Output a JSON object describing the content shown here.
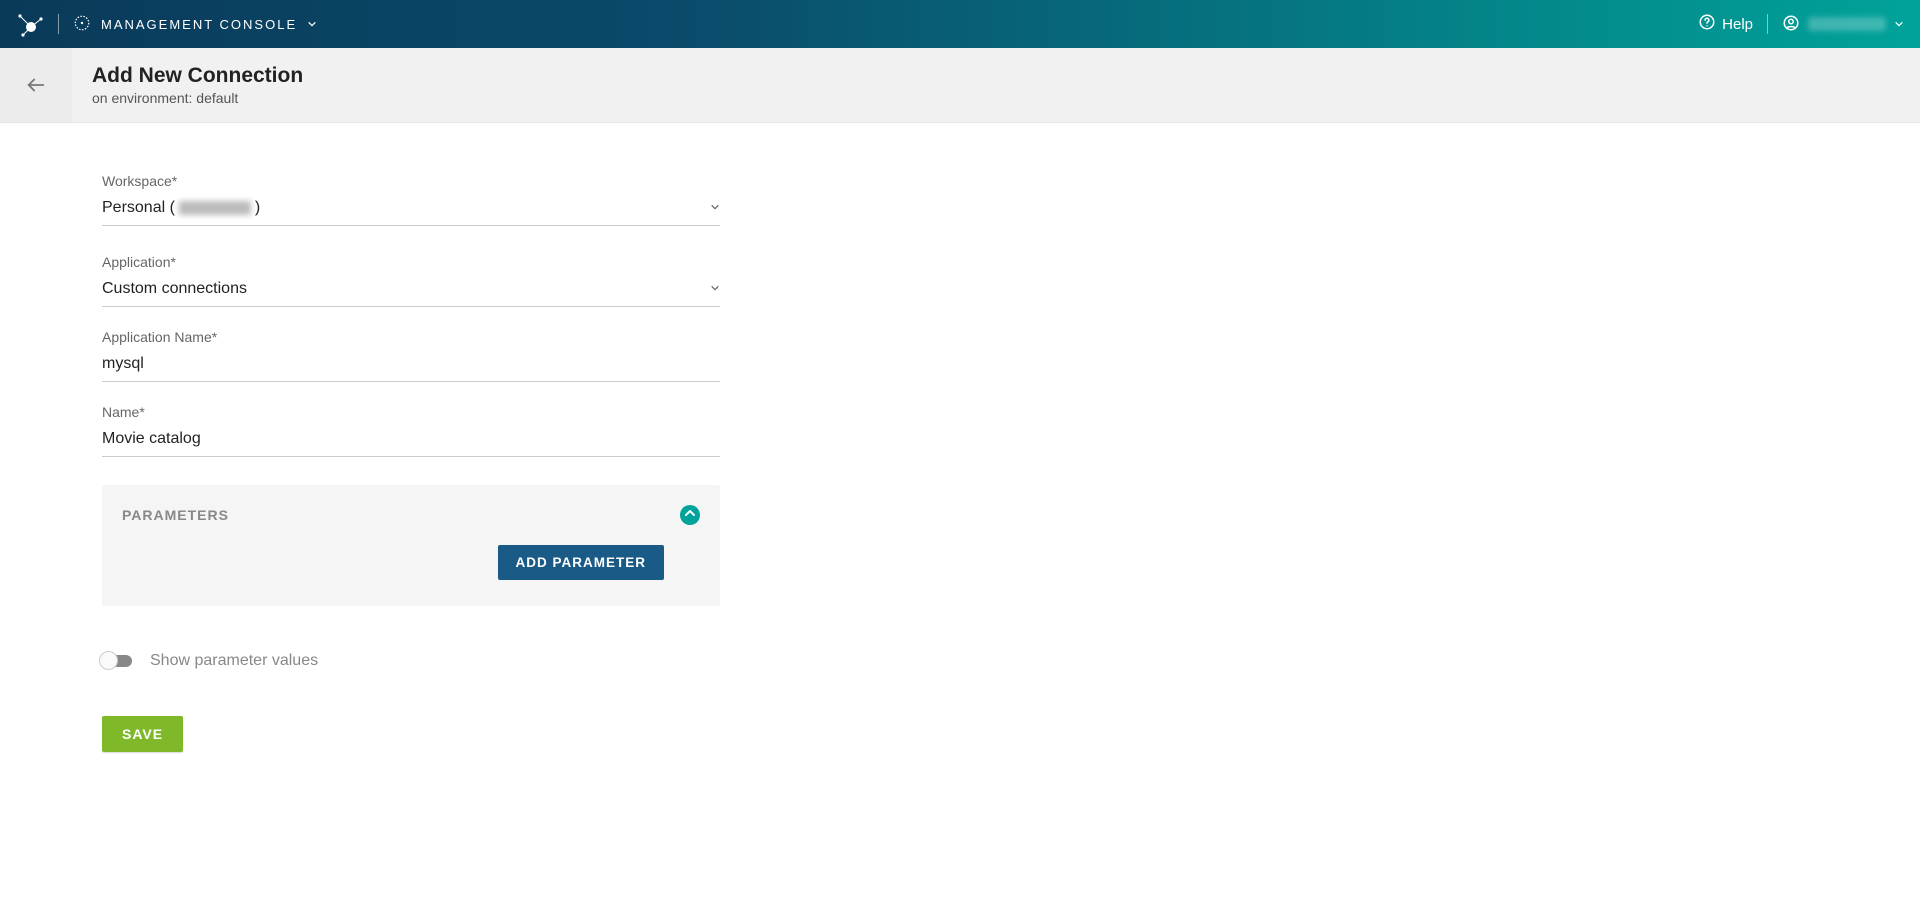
{
  "topnav": {
    "app_switch_label": "MANAGEMENT CONSOLE",
    "help_label": "Help"
  },
  "header": {
    "title": "Add New Connection",
    "subtitle": "on environment: default"
  },
  "form": {
    "workspace": {
      "label": "Workspace*",
      "value_prefix": "Personal (",
      "value_suffix": ")"
    },
    "application": {
      "label": "Application*",
      "value": "Custom connections"
    },
    "application_name": {
      "label": "Application Name*",
      "value": "mysql"
    },
    "name": {
      "label": "Name*",
      "value": "Movie catalog"
    }
  },
  "parameters": {
    "title": "PARAMETERS",
    "add_button": "ADD PARAMETER"
  },
  "toggle": {
    "label": "Show parameter values",
    "checked": false
  },
  "actions": {
    "save": "SAVE"
  }
}
